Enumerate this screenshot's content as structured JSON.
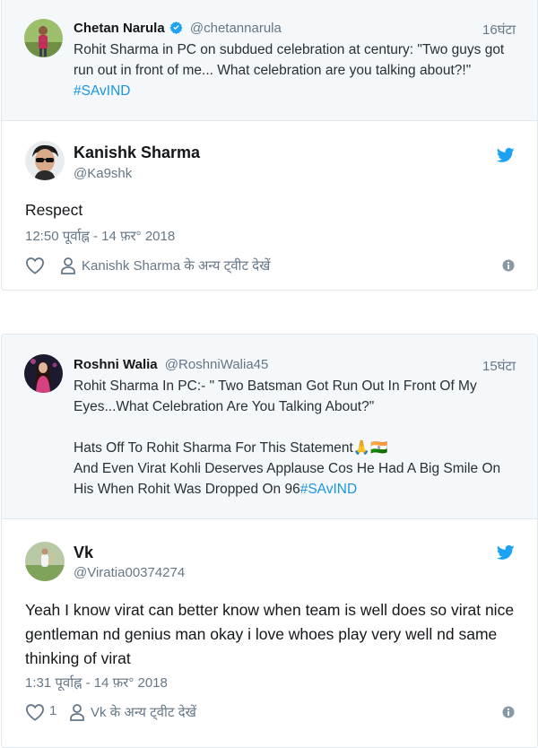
{
  "tweets": [
    {
      "quoted": {
        "name": "Chetan Narula",
        "handle": "@chetannarula",
        "time": "16घंटा",
        "text": "Rohit Sharma in PC on subdued celebration at century: \"Two guys got run out in front of me... What celebration are you talking about?!\" ",
        "hashtag": "#SAvIND"
      },
      "reply": {
        "name": "Kanishk Sharma",
        "handle": "@Ka9shk",
        "text": "Respect",
        "timestamp": "12:50 पूर्वाह्न - 14 फ़र° 2018",
        "like_count": "",
        "more_tweets": "Kanishk Sharma के अन्य ट्वीट देखें"
      }
    },
    {
      "quoted": {
        "name": "Roshni Walia",
        "handle": "@RoshniWalia45",
        "time": "15घंटा",
        "text_line1": "Rohit Sharma In PC:- \" Two Batsman Got Run Out In Front Of My Eyes...What Celebration Are You Talking About?\"",
        "text_line2": "Hats Off To Rohit Sharma For This Statement🙏🇮🇳",
        "text_line3": "And Even Virat Kohli Deserves Applause Cos He Had A Big Smile On His When Rohit Was Dropped On 96",
        "hashtag": "#SAvIND"
      },
      "reply": {
        "name": "Vk",
        "handle": "@Viratia00374274",
        "text": "Yeah I know virat can better know when team is well does so virat nice gentleman nd genius man okay i love whoes play very well nd same thinking of virat",
        "timestamp": "1:31 पूर्वाह्न - 14 फ़र° 2018",
        "like_count": "1",
        "more_tweets": "Vk के अन्य ट्वीट देखें"
      }
    }
  ],
  "colors": {
    "link": "#1b95e0",
    "twitter_blue": "#1da1f2",
    "muted": "#657786",
    "border": "#e1e8ed",
    "quoted_bg": "#f5f8fa"
  },
  "icons": [
    "verified-badge-icon",
    "twitter-bird-icon",
    "heart-icon",
    "user-icon",
    "info-icon"
  ]
}
